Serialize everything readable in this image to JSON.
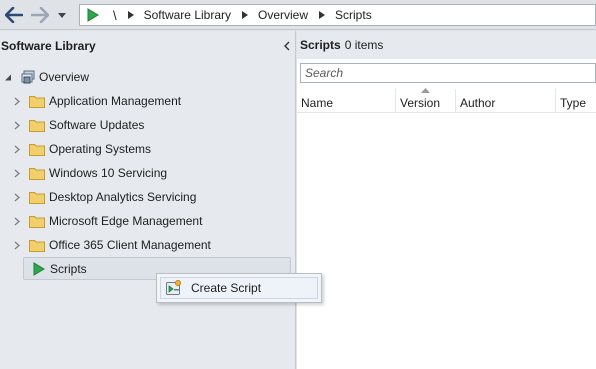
{
  "breadcrumb": {
    "root": "\\",
    "items": [
      "Software Library",
      "Overview",
      "Scripts"
    ]
  },
  "left_pane": {
    "title": "Software Library",
    "tree": {
      "root_label": "Overview",
      "children": [
        {
          "label": "Application Management"
        },
        {
          "label": "Software Updates"
        },
        {
          "label": "Operating Systems"
        },
        {
          "label": "Windows 10 Servicing"
        },
        {
          "label": "Desktop Analytics Servicing"
        },
        {
          "label": "Microsoft Edge Management"
        },
        {
          "label": "Office 365 Client Management"
        }
      ],
      "selected_label": "Scripts"
    }
  },
  "right_pane": {
    "title": "Scripts",
    "count": "0 items",
    "search_placeholder": "Search",
    "columns": [
      "Name",
      "Version",
      "Author",
      "Type"
    ]
  },
  "context_menu": {
    "items": [
      {
        "label": "Create Script",
        "icon": "create-script-icon"
      }
    ]
  },
  "colors": {
    "folder": "#e8c060",
    "green_arrow": "#2ea84a",
    "pane_bg": "#e6e9ed"
  }
}
